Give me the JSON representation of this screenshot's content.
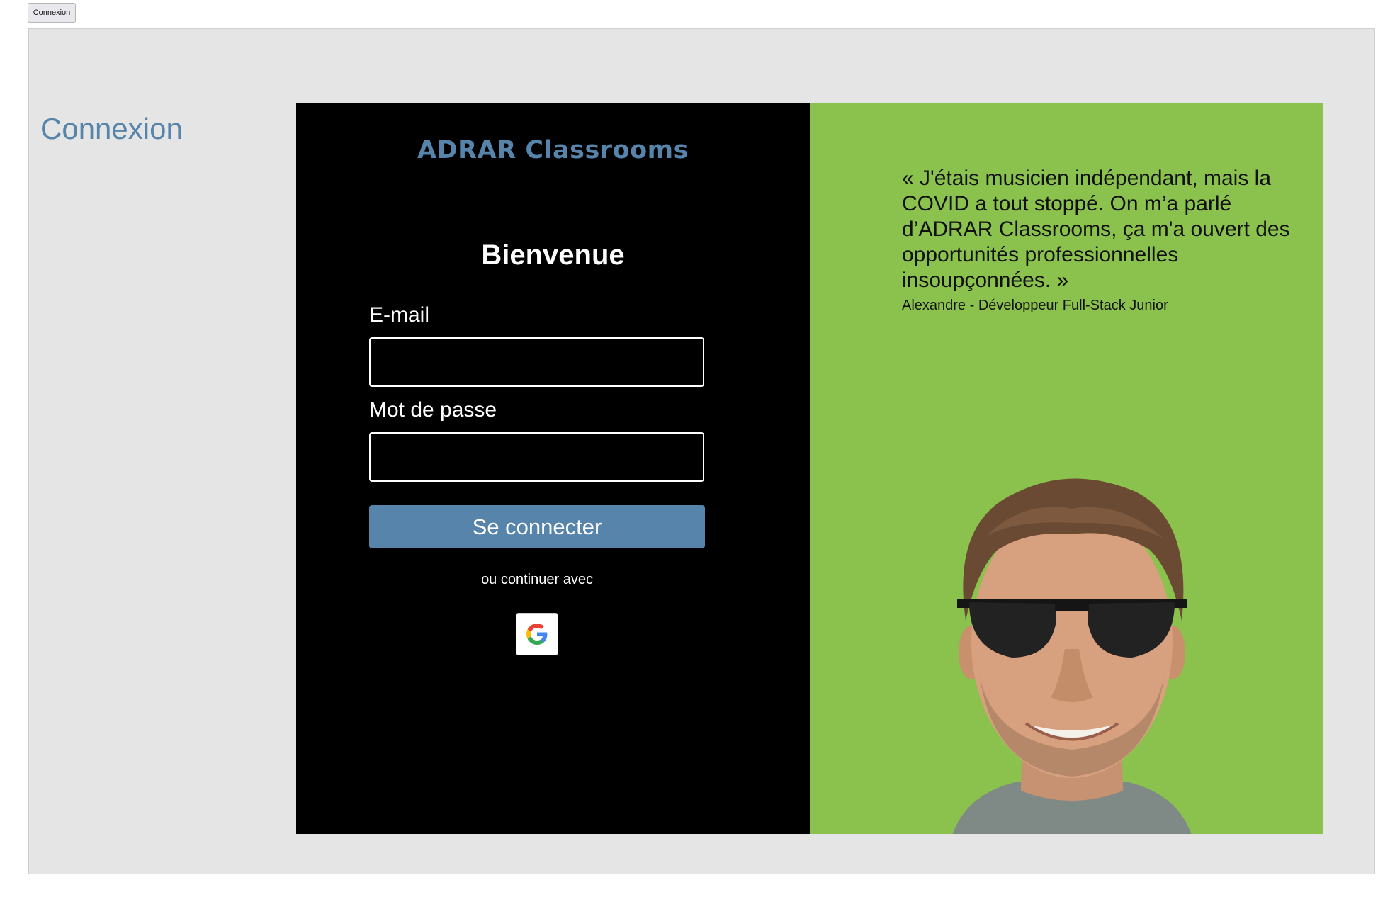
{
  "top_button": {
    "label": "Connexion"
  },
  "page": {
    "title": "Connexion"
  },
  "login": {
    "brand": "ADRAR Classrooms",
    "welcome": "Bienvenue",
    "email_label": "E-mail",
    "email_value": "",
    "password_label": "Mot de passe",
    "password_value": "",
    "submit_label": "Se connecter",
    "divider_text": "ou continuer avec",
    "google_icon": "google-icon"
  },
  "testimonial": {
    "quote": "« J'étais musicien indépendant, mais la COVID a tout stoppé. On m’a parlé d’ADRAR Classrooms, ça m'a ouvert des opportunités professionnelles insoupçonnées. »",
    "author": "Alexandre - Développeur Full-Stack Junior"
  },
  "colors": {
    "accent": "#5784ab",
    "panel_dark": "#000000",
    "panel_green": "#8bc14d",
    "frame_bg": "#e5e5e5"
  }
}
